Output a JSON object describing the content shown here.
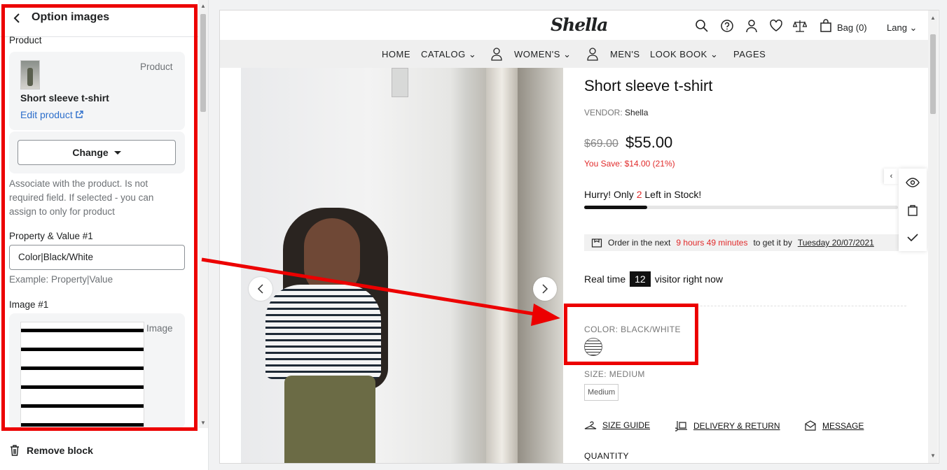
{
  "sidebar": {
    "title": "Option images",
    "product_heading": "Product",
    "product_badge": "Product",
    "product_name": "Short sleeve t-shirt",
    "edit_link": "Edit product",
    "change_label": "Change",
    "help_text": "Associate with the product. Is not required field. If selected - you can assign to only for product",
    "property_label": "Property & Value #1",
    "property_value": "Color|Black/White",
    "property_example": "Example: Property|Value",
    "image_label": "Image #1",
    "image_badge": "Image",
    "remove_label": "Remove block"
  },
  "store": {
    "logo": "Shella",
    "bag": "Bag (0)",
    "lang": "Lang",
    "nav": [
      "HOME",
      "CATALOG",
      "WOMEN'S",
      "MEN'S",
      "LOOK BOOK",
      "PAGES"
    ]
  },
  "product": {
    "title": "Short sleeve t-shirt",
    "vendor_label": "VENDOR:",
    "vendor": "Shella",
    "old_price": "$69.00",
    "price": "$55.00",
    "save": "You Save: $14.00 (21%)",
    "hurry_pre": "Hurry! Only",
    "hurry_count": "2",
    "hurry_post": "Left in Stock!",
    "stock_progress_percent": 20,
    "order_pre": "Order in the next",
    "order_time": "9 hours 49 minutes",
    "order_mid": "to get it by",
    "order_date": "Tuesday 20/07/2021",
    "realtime_pre": "Real time",
    "visitors": "12",
    "realtime_post": "visitor right now",
    "color_label": "COLOR:",
    "color_value": "BLACK/WHITE",
    "size_label": "SIZE:",
    "size_value": "MEDIUM",
    "size_option": "Medium",
    "size_guide": "SIZE GUIDE",
    "delivery": "DELIVERY & RETURN",
    "message": "MESSAGE",
    "quantity": "QUANTITY"
  },
  "colors": {
    "highlight": "#ec0000",
    "accent_red": "#e12b2b",
    "link_blue": "#2c6ecb"
  }
}
